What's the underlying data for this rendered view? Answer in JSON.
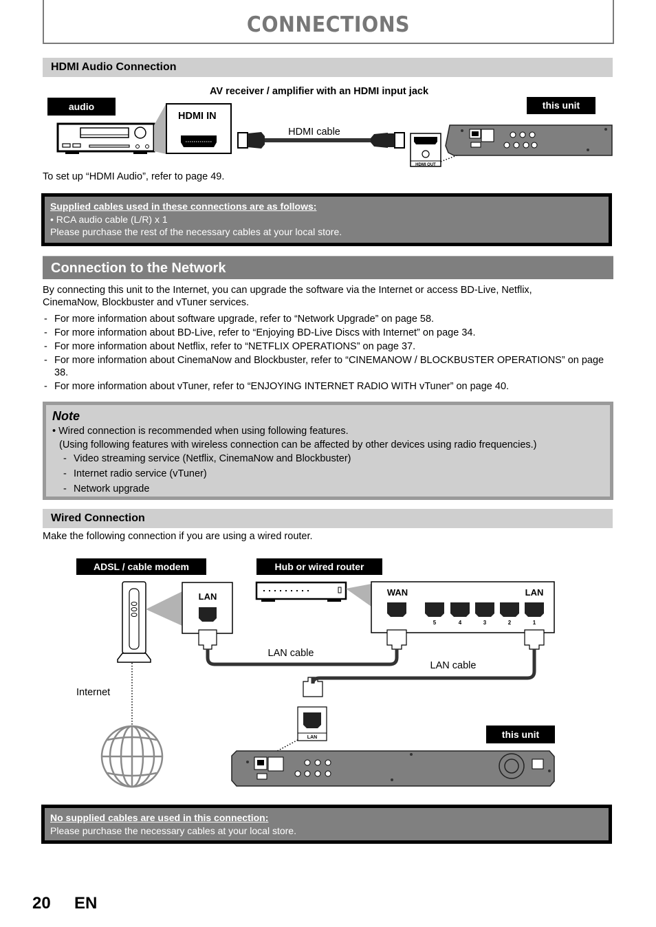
{
  "page": {
    "title": "CONNECTIONS",
    "page_number": "20",
    "language": "EN"
  },
  "hdmi_audio": {
    "heading": "HDMI Audio Connection",
    "diagram": {
      "device_caption": "AV receiver / amplifier with an HDMI input jack",
      "audio_label": "audio",
      "this_unit_label": "this unit",
      "hdmi_in_label": "HDMI IN",
      "cable_label": "HDMI cable",
      "hdmi_out_label": "HDMI OUT"
    },
    "setup_note": "To set up “HDMI Audio”, refer to page 49.",
    "supplied_cables": {
      "heading": "Supplied cables used in these connections are as follows:",
      "items": [
        "RCA audio cable (L/R) x 1"
      ],
      "footer": "Please purchase the rest of the necessary cables at your local store."
    }
  },
  "network": {
    "heading": "Connection to the Network",
    "intro": "By connecting this unit to the Internet, you can upgrade the software via the Internet or access BD-Live, Netflix, CinemaNow, Blockbuster and vTuner services.",
    "references": [
      "For more information about software upgrade, refer to “Network Upgrade” on page 58.",
      "For more information about BD-Live, refer to “Enjoying BD-Live Discs with Internet” on page 34.",
      "For more information about Netflix, refer to “NETFLIX OPERATIONS” on page 37.",
      "For more information about CinemaNow and Blockbuster, refer to “CINEMANOW / BLOCKBUSTER OPERATIONS” on page 38.",
      "For more information about vTuner, refer to “ENJOYING INTERNET RADIO WITH vTuner” on page 40."
    ],
    "note": {
      "title": "Note",
      "bullet": "Wired connection is recommended when using following features.",
      "paren": "(Using following features with wireless connection can be affected by other devices using radio frequencies.)",
      "features": [
        "Video streaming service (Netflix, CinemaNow and Blockbuster)",
        "Internet radio service (vTuner)",
        "Network upgrade"
      ]
    }
  },
  "wired": {
    "heading": "Wired Connection",
    "intro": "Make the following connection if you are using a wired router.",
    "diagram": {
      "modem_label": "ADSL / cable modem",
      "router_label": "Hub or wired router",
      "modem_lan": "LAN",
      "wan": "WAN",
      "router_lan": "LAN",
      "ports": [
        "5",
        "4",
        "3",
        "2",
        "1"
      ],
      "cable1": "LAN cable",
      "cable2": "LAN cable",
      "internet": "Internet",
      "unit_lan": "LAN",
      "this_unit_label": "this unit"
    },
    "supplied_cables": {
      "heading": "No supplied cables are used in this connection:",
      "footer": "Please purchase the necessary cables at your local store."
    }
  }
}
